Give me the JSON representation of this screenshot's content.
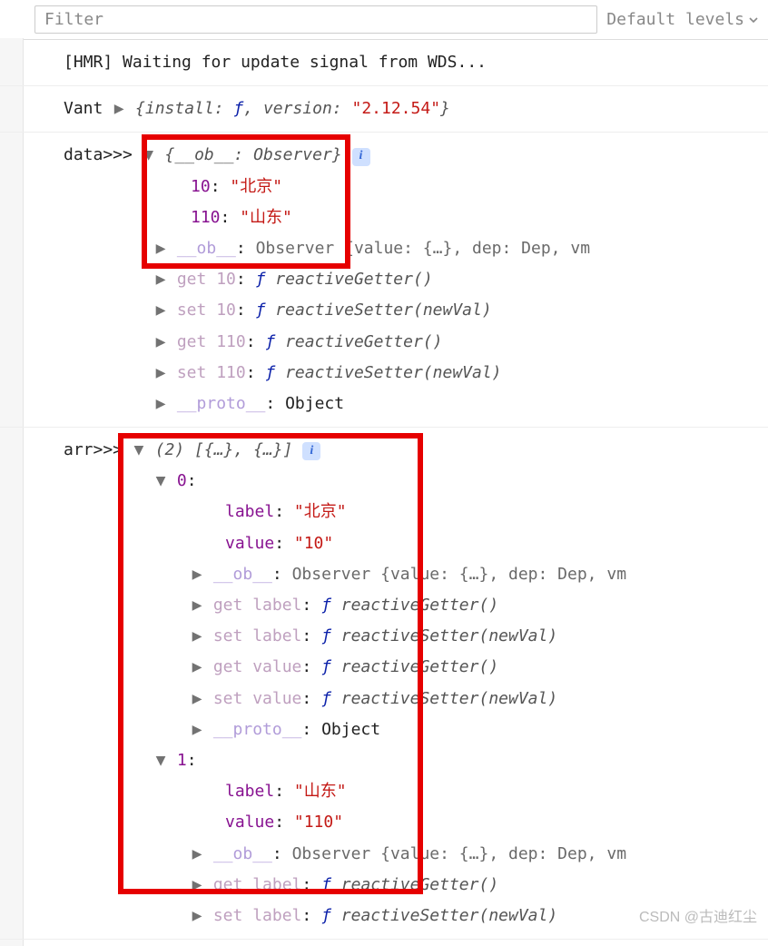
{
  "toolbar": {
    "filter_placeholder": "Filter",
    "levels_label": "Default levels"
  },
  "line_hmr": "[HMR] Waiting for update signal from WDS...",
  "vant": {
    "prefix": "Vant ",
    "install_key": "install",
    "version_key": "version",
    "version_val": "\"2.12.54\"",
    "fn": "ƒ"
  },
  "dataBlock": {
    "prefix": "data>>> ",
    "ob_key": "__ob__",
    "observer": "Observer",
    "entries": [
      {
        "k": "10",
        "v": "\"北京\""
      },
      {
        "k": "110",
        "v": "\"山东\""
      }
    ],
    "ob_tail": "{value: {…}, dep: Dep, vm",
    "getset": [
      {
        "gs": "get",
        "k": "10",
        "fn": "reactiveGetter()"
      },
      {
        "gs": "set",
        "k": "10",
        "fn": "reactiveSetter(newVal)"
      },
      {
        "gs": "get",
        "k": "110",
        "fn": "reactiveGetter()"
      },
      {
        "gs": "set",
        "k": "110",
        "fn": "reactiveSetter(newVal)"
      }
    ],
    "proto_key": "__proto__",
    "proto_val": "Object"
  },
  "arrBlock": {
    "prefix": "arr>>> ",
    "header": "(2) [{…}, {…}]",
    "items": [
      {
        "idx": "0",
        "label_key": "label",
        "label_val": "\"北京\"",
        "value_key": "value",
        "value_val": "\"10\"",
        "ob_tail": "{value: {…}, dep: Dep, vm",
        "getset": [
          {
            "gs": "get",
            "k": "label",
            "fn": "reactiveGetter()"
          },
          {
            "gs": "set",
            "k": "label",
            "fn": "reactiveSetter(newVal)"
          },
          {
            "gs": "get",
            "k": "value",
            "fn": "reactiveGetter()"
          },
          {
            "gs": "set",
            "k": "value",
            "fn": "reactiveSetter(newVal)"
          }
        ],
        "proto_val": "Object"
      },
      {
        "idx": "1",
        "label_key": "label",
        "label_val": "\"山东\"",
        "value_key": "value",
        "value_val": "\"110\"",
        "ob_tail": "{value: {…}, dep: Dep, vm",
        "getset": [
          {
            "gs": "get",
            "k": "label",
            "fn": "reactiveGetter()"
          },
          {
            "gs": "set",
            "k": "label",
            "fn": "reactiveSetter(newVal)"
          }
        ]
      }
    ]
  },
  "watermark": "CSDN @古迪红尘"
}
